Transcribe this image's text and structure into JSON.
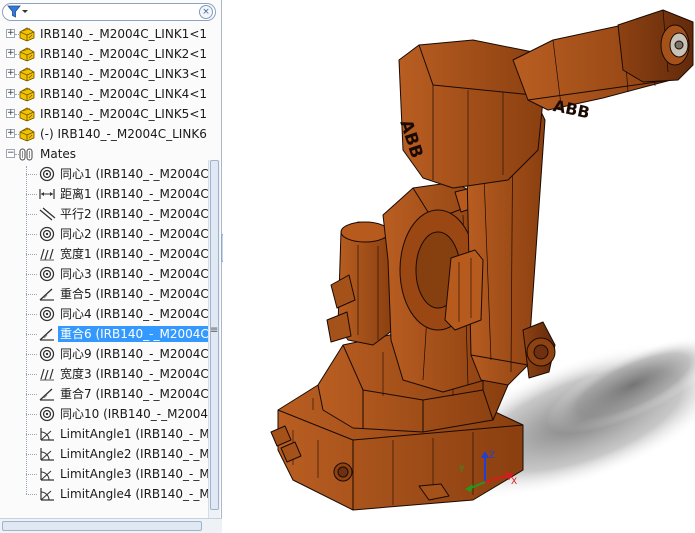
{
  "filter": {
    "clear_glyph": "×"
  },
  "tree": {
    "rows": [
      {
        "label": "IRB140_-_M2004C_LINK1<1>",
        "icon": "part-icon",
        "expander": "+",
        "selected": false
      },
      {
        "label": "IRB140_-_M2004C_LINK2<1>",
        "icon": "part-icon",
        "expander": "+",
        "selected": false
      },
      {
        "label": "IRB140_-_M2004C_LINK3<1>",
        "icon": "part-icon",
        "expander": "+",
        "selected": false
      },
      {
        "label": "IRB140_-_M2004C_LINK4<1>",
        "icon": "part-icon",
        "expander": "+",
        "selected": false
      },
      {
        "label": "IRB140_-_M2004C_LINK5<1>",
        "icon": "part-icon",
        "expander": "+",
        "selected": false
      },
      {
        "label": "(-) IRB140_-_M2004C_LINK6<",
        "icon": "part-icon",
        "expander": "+",
        "selected": false
      },
      {
        "label": "Mates",
        "icon": "mates-icon",
        "expander": "−",
        "selected": false
      },
      {
        "label": "同心1 (IRB140_-_M2004C_",
        "icon": "concentric-icon",
        "expander": "",
        "selected": false
      },
      {
        "label": "距离1 (IRB140_-_M2004C_",
        "icon": "distance-icon",
        "expander": "",
        "selected": false
      },
      {
        "label": "平行2 (IRB140_-_M2004C_",
        "icon": "parallel-icon",
        "expander": "",
        "selected": false
      },
      {
        "label": "同心2 (IRB140_-_M2004C_",
        "icon": "concentric-icon",
        "expander": "",
        "selected": false
      },
      {
        "label": "宽度1 (IRB140_-_M2004C_",
        "icon": "width-icon",
        "expander": "",
        "selected": false
      },
      {
        "label": "同心3 (IRB140_-_M2004C_",
        "icon": "concentric-icon",
        "expander": "",
        "selected": false
      },
      {
        "label": "重合5 (IRB140_-_M2004C_",
        "icon": "coincident-icon",
        "expander": "",
        "selected": false
      },
      {
        "label": "同心4 (IRB140_-_M2004C_",
        "icon": "concentric-icon",
        "expander": "",
        "selected": false
      },
      {
        "label": "重合6 (IRB140_-_M2004C_",
        "icon": "coincident-icon",
        "expander": "",
        "selected": true
      },
      {
        "label": "同心9 (IRB140_-_M2004C_",
        "icon": "concentric-icon",
        "expander": "",
        "selected": false
      },
      {
        "label": "宽度3 (IRB140_-_M2004C_",
        "icon": "width-icon",
        "expander": "",
        "selected": false
      },
      {
        "label": "重合7 (IRB140_-_M2004C_",
        "icon": "coincident-icon",
        "expander": "",
        "selected": false
      },
      {
        "label": "同心10 (IRB140_-_M2004C",
        "icon": "concentric-icon",
        "expander": "",
        "selected": false
      },
      {
        "label": "LimitAngle1 (IRB140_-_M2",
        "icon": "limit-angle-icon",
        "expander": "",
        "selected": false
      },
      {
        "label": "LimitAngle2 (IRB140_-_M2",
        "icon": "limit-angle-icon",
        "expander": "",
        "selected": false
      },
      {
        "label": "LimitAngle3 (IRB140_-_M2",
        "icon": "limit-angle-icon",
        "expander": "",
        "selected": false
      },
      {
        "label": "LimitAngle4 (IRB140_-_M2",
        "icon": "limit-angle-icon",
        "expander": "",
        "selected": false
      }
    ]
  },
  "viewport": {
    "model_colors": {
      "body": "#9c4a14",
      "light": "#b65a1e",
      "dark": "#6e3010",
      "edge": "#1a0a02"
    },
    "model_logo_1": "ABB",
    "model_logo_2": "ABB"
  },
  "triad": {
    "x_label": "X",
    "y_label": "Y",
    "z_label": "Z",
    "x_color": "#d61c1c",
    "y_color": "#1f9b1f",
    "z_color": "#1f3fd6"
  },
  "scroll": {
    "grip_glyph": "≡",
    "collapse_glyph": "◂"
  }
}
